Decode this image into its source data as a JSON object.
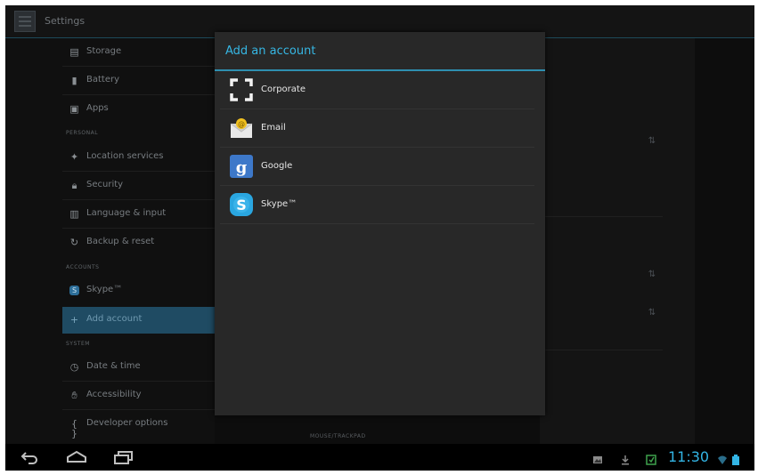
{
  "action_bar": {
    "title": "Settings",
    "icon": "settings-icon"
  },
  "left_pane": {
    "items": [
      {
        "label": "Storage",
        "icon": "storage-icon"
      },
      {
        "label": "Battery",
        "icon": "battery-icon"
      },
      {
        "label": "Apps",
        "icon": "apps-icon"
      },
      {
        "label": "Location services",
        "icon": "location-icon"
      },
      {
        "label": "Security",
        "icon": "lock-icon"
      },
      {
        "label": "Language & input",
        "icon": "language-icon"
      },
      {
        "label": "Backup & reset",
        "icon": "backup-icon"
      },
      {
        "label": "Skype™",
        "icon": "skype-icon"
      },
      {
        "label": "Add account",
        "icon": "add-icon"
      },
      {
        "label": "Date & time",
        "icon": "clock-icon"
      },
      {
        "label": "Accessibility",
        "icon": "accessibility-icon"
      },
      {
        "label": "Developer options",
        "icon": "developer-icon"
      }
    ],
    "headers": {
      "personal": "PERSONAL",
      "accounts": "ACCOUNTS",
      "system": "SYSTEM"
    }
  },
  "right_pane": {
    "track_label": "MOUSE/TRACKPAD"
  },
  "dialog": {
    "title": "Add an account",
    "accounts": [
      {
        "label": "Corporate",
        "icon": "corporate-icon"
      },
      {
        "label": "Email",
        "icon": "email-icon"
      },
      {
        "label": "Google",
        "icon": "google-icon"
      },
      {
        "label": "Skype™",
        "icon": "skype-icon"
      }
    ]
  },
  "nav_bar": {
    "clock": "11:30"
  },
  "colors": {
    "accent": "#33b5e5",
    "selected": "#1f4b63",
    "dialog_bg": "#282828"
  }
}
